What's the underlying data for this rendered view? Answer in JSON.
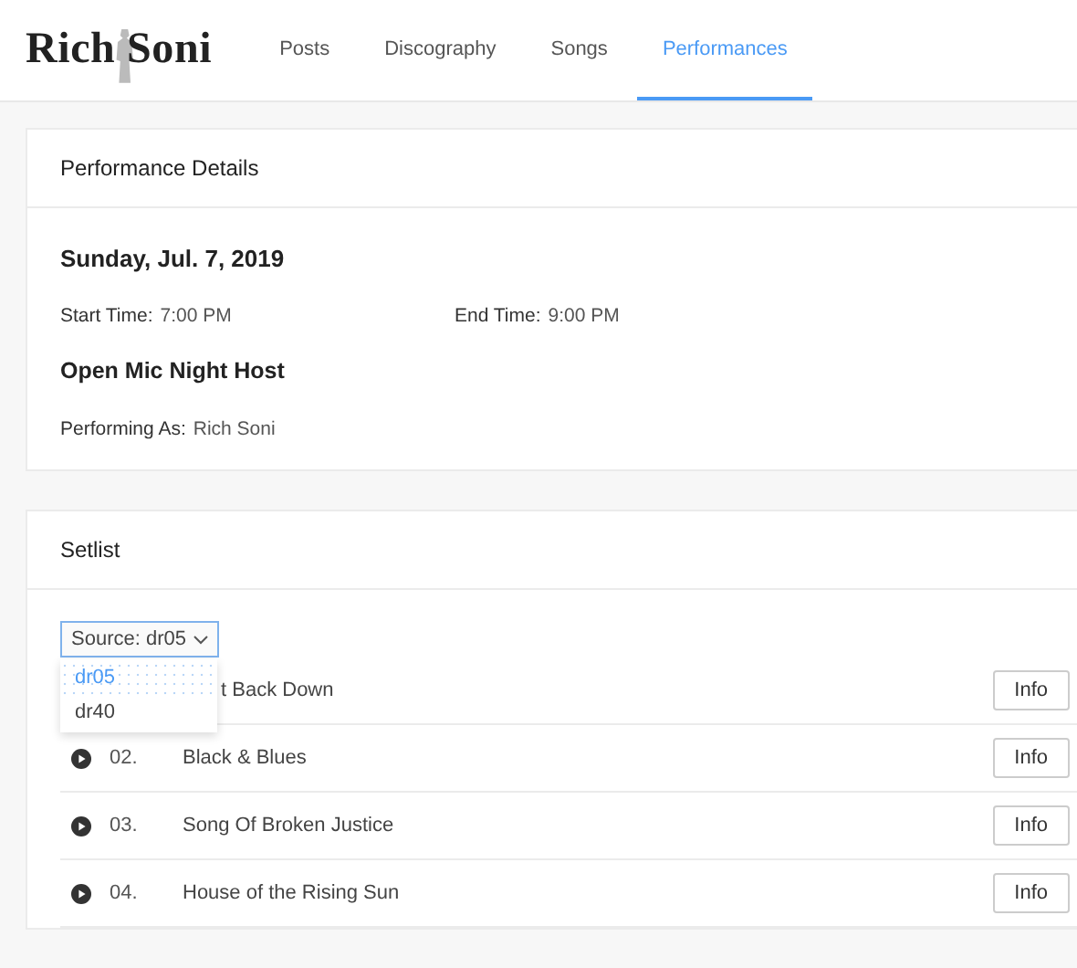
{
  "header": {
    "logo": "Rich Soni",
    "tabs": [
      {
        "label": "Posts",
        "selected": false
      },
      {
        "label": "Discography",
        "selected": false
      },
      {
        "label": "Songs",
        "selected": false
      },
      {
        "label": "Performances",
        "selected": true
      }
    ]
  },
  "details": {
    "title": "Performance Details",
    "date": "Sunday, Jul. 7, 2019",
    "start_label": "Start Time:",
    "start_value": "7:00 PM",
    "end_label": "End Time:",
    "end_value": "9:00 PM",
    "event": "Open Mic Night Host",
    "performing_label": "Performing As:",
    "performing_value": "Rich Soni"
  },
  "setlist": {
    "title": "Setlist",
    "source": {
      "label": "Source: dr05",
      "expanded": true,
      "options": [
        {
          "label": "dr05",
          "selected": true
        },
        {
          "label": "dr40",
          "selected": false
        }
      ]
    },
    "rows": [
      {
        "title": "t Back Down",
        "button": "Info"
      },
      {
        "number": "02.",
        "title": "Black & Blues",
        "button": "Info"
      },
      {
        "number": "03.",
        "title": "Song Of Broken Justice",
        "button": "Info"
      },
      {
        "number": "04.",
        "title": "House of the Rising Sun",
        "button": "Info"
      }
    ]
  }
}
